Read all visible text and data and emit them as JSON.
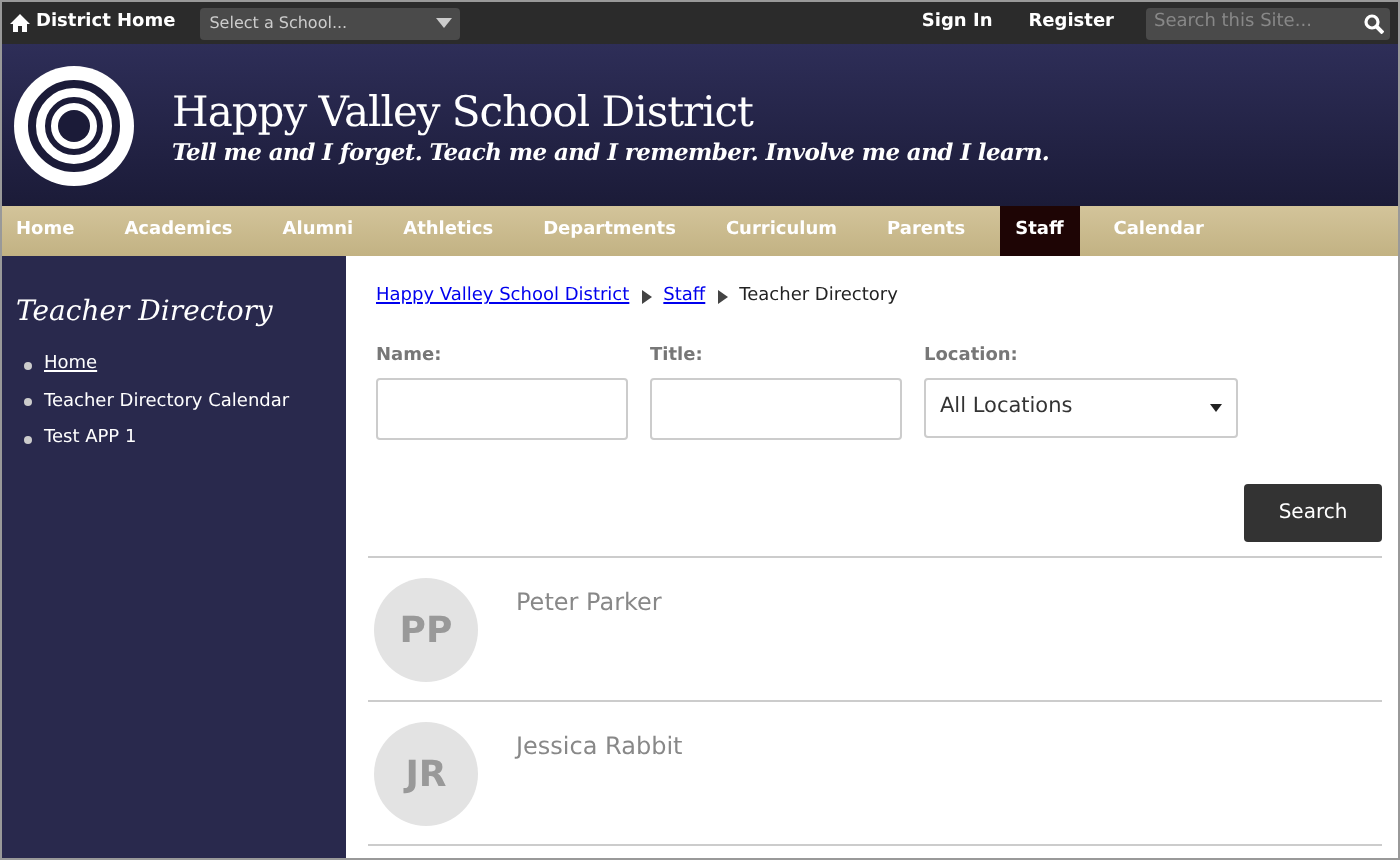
{
  "top_bar": {
    "home_link": "District Home",
    "school_select": {
      "placeholder": "Select a School..."
    },
    "links": [
      "Sign In",
      "Register"
    ],
    "search": {
      "placeholder": "Search this Site..."
    }
  },
  "header": {
    "title": "Happy Valley School District",
    "tagline": "Tell me and I forget. Teach me and I remember. Involve me and I learn."
  },
  "nav": [
    {
      "label": "Home",
      "selected": false
    },
    {
      "label": "Academics",
      "selected": false
    },
    {
      "label": "Alumni",
      "selected": false
    },
    {
      "label": "Athletics",
      "selected": false
    },
    {
      "label": "Departments",
      "selected": false
    },
    {
      "label": "Curriculum",
      "selected": false
    },
    {
      "label": "Parents",
      "selected": false
    },
    {
      "label": "Staff",
      "selected": true
    },
    {
      "label": "Calendar",
      "selected": false
    }
  ],
  "sidebar": {
    "title": "Teacher Directory",
    "items": [
      {
        "label": "Home",
        "kind": "link"
      },
      {
        "label": "Teacher Directory Calendar",
        "kind": "plain"
      },
      {
        "label": "Test APP 1",
        "kind": "plain"
      }
    ]
  },
  "breadcrumb": [
    {
      "label": "Happy Valley School District",
      "kind": "link"
    },
    {
      "label": "Staff",
      "kind": "link"
    },
    {
      "label": "Teacher Directory",
      "kind": "current"
    }
  ],
  "filters": {
    "name_label": "Name:",
    "title_label": "Title:",
    "location_label": "Location:",
    "location_value": "All Locations",
    "search_button": "Search"
  },
  "people": [
    {
      "initials": "PP",
      "name": "Peter Parker"
    },
    {
      "initials": "JR",
      "name": "Jessica Rabbit"
    }
  ]
}
